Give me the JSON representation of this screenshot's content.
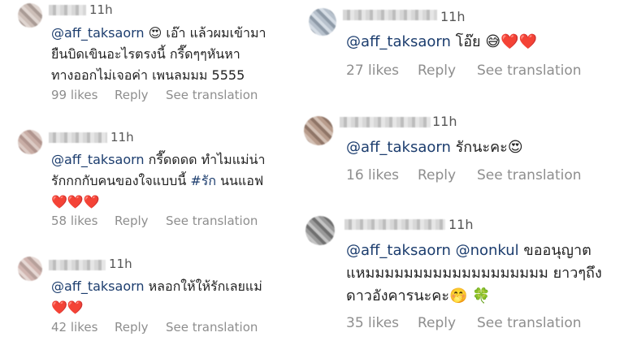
{
  "comments": [
    {
      "time": "11h",
      "mention": "@aff_taksaorn",
      "line1_rest": " 😍 เอ๊า แล้วผมเข้ามา",
      "line2": "ยืนบิดเขินอะไรตรงนี้ กรี๊ดๆๆหันหา",
      "line3": "ทางออกไม่เจอค่า เพนลมมม 5555",
      "likes": "99 likes",
      "reply": "Reply",
      "translate": "See translation"
    },
    {
      "time": "11h",
      "mention": "@aff_taksaorn",
      "line1_rest": " กรี๊ดดดด ทำไมแม่น่า",
      "line2_a": "รักกกกับคนของใจแบบนี้ ",
      "hashtag": "#รัก",
      "line2_b": " นนแอฟ",
      "line3": "❤️❤️❤️",
      "likes": "58 likes",
      "reply": "Reply",
      "translate": "See translation"
    },
    {
      "time": "11h",
      "mention": "@aff_taksaorn",
      "line1_rest": " หลอกให้ให้รักเลยแม่",
      "line2": "❤️❤️",
      "likes": "42 likes",
      "reply": "Reply",
      "translate": "See translation"
    },
    {
      "time": "11h",
      "mention": "@aff_taksaorn",
      "line1_rest": " โอ๊ย 😅❤️❤️",
      "likes": "27 likes",
      "reply": "Reply",
      "translate": "See translation"
    },
    {
      "time": "11h",
      "mention": "@aff_taksaorn",
      "line1_rest": " รักนะคะ😍",
      "likes": "16 likes",
      "reply": "Reply",
      "translate": "See translation"
    },
    {
      "time": "11h",
      "mention": "@aff_taksaorn @nonkul",
      "line1_rest": " ขออนุญาต",
      "line2": "แหมมมมมมมมมมมมมมมมมมม ยาวๆถึง",
      "line3": "ดาวอังคารนะคะ🤭 🍀",
      "likes": "35 likes",
      "reply": "Reply",
      "translate": "See translation"
    }
  ]
}
